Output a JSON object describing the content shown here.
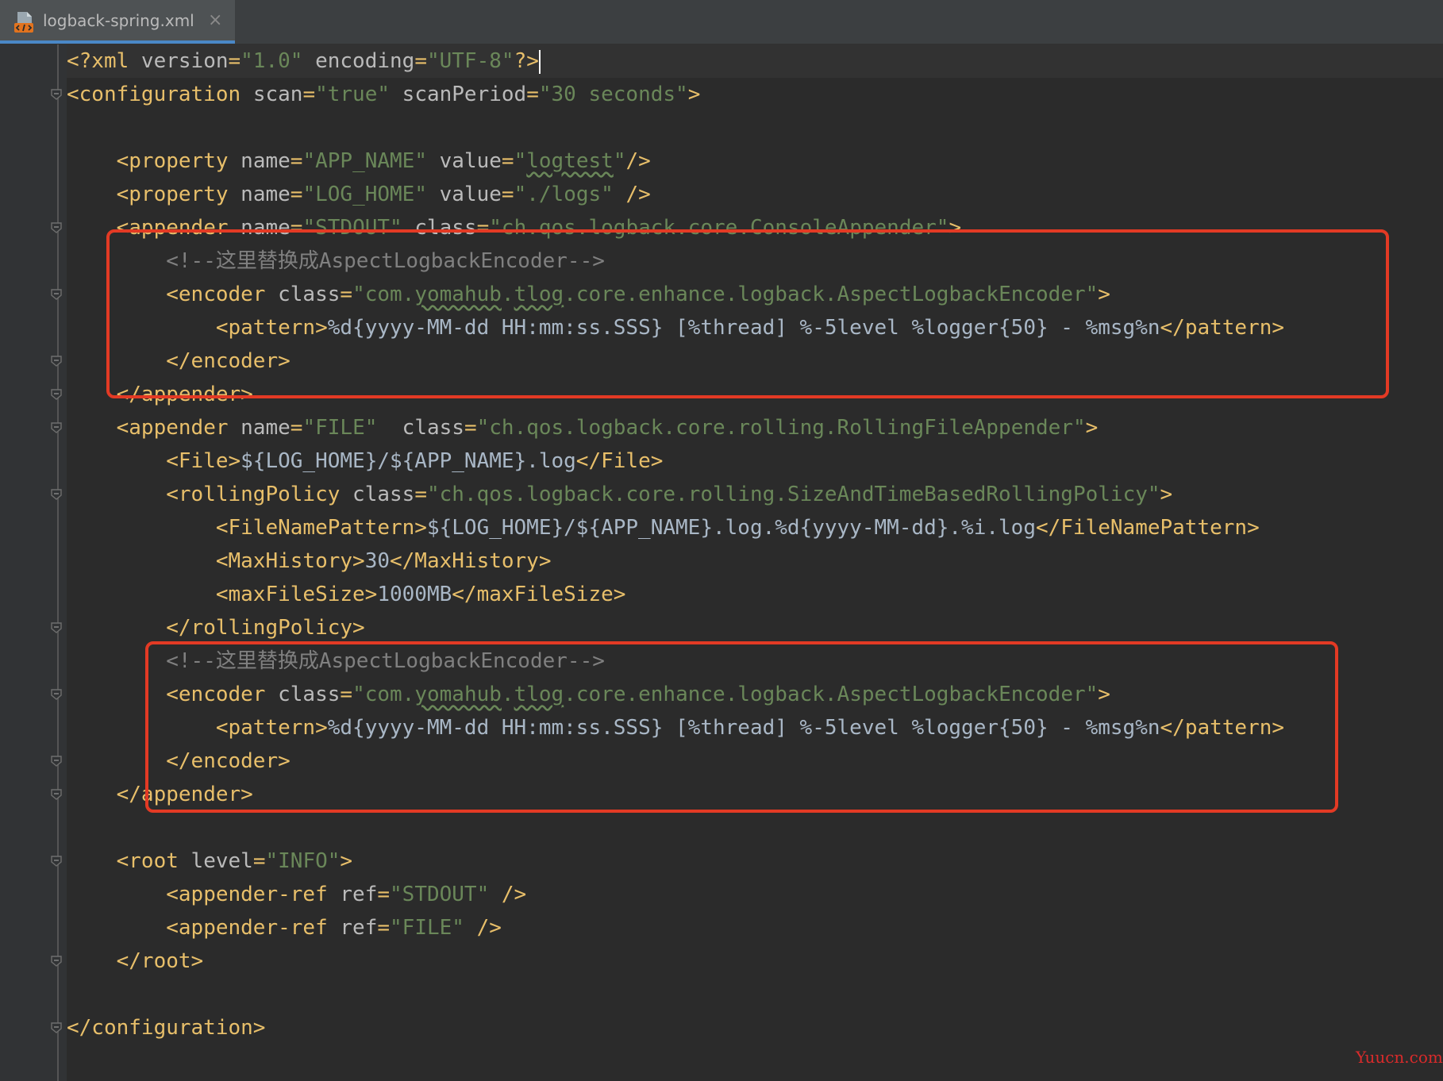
{
  "tab": {
    "filename": "logback-spring.xml",
    "close_glyph": "×",
    "icon": "xml-file-icon"
  },
  "code": [
    [
      [
        "tag",
        "<?xml "
      ],
      [
        "attr",
        "version"
      ],
      [
        "tag",
        "="
      ],
      [
        "val",
        "\"1.0\""
      ],
      [
        "attr",
        " encoding"
      ],
      [
        "tag",
        "="
      ],
      [
        "val",
        "\"UTF-8\""
      ],
      [
        "tag",
        "?>"
      ]
    ],
    [
      [
        "tag",
        "<configuration "
      ],
      [
        "attr",
        "scan"
      ],
      [
        "tag",
        "="
      ],
      [
        "val",
        "\"true\""
      ],
      [
        "attr",
        " scanPeriod"
      ],
      [
        "tag",
        "="
      ],
      [
        "val",
        "\"30 seconds\""
      ],
      [
        "tag",
        ">"
      ]
    ],
    [],
    [
      [
        "txt",
        "    "
      ],
      [
        "tag",
        "<property "
      ],
      [
        "attr",
        "name"
      ],
      [
        "tag",
        "="
      ],
      [
        "val",
        "\"APP_NAME\""
      ],
      [
        "attr",
        " value"
      ],
      [
        "tag",
        "="
      ],
      [
        "val",
        "\""
      ],
      [
        "valsq",
        "logtest"
      ],
      [
        "val",
        "\""
      ],
      [
        "tag",
        "/>"
      ]
    ],
    [
      [
        "txt",
        "    "
      ],
      [
        "tag",
        "<property "
      ],
      [
        "attr",
        "name"
      ],
      [
        "tag",
        "="
      ],
      [
        "val",
        "\"LOG_HOME\""
      ],
      [
        "attr",
        " value"
      ],
      [
        "tag",
        "="
      ],
      [
        "val",
        "\"./logs\""
      ],
      [
        "tag",
        " />"
      ]
    ],
    [
      [
        "txt",
        "    "
      ],
      [
        "tag",
        "<appender "
      ],
      [
        "attr",
        "name"
      ],
      [
        "tag",
        "="
      ],
      [
        "val",
        "\"STDOUT\""
      ],
      [
        "attr",
        " class"
      ],
      [
        "tag",
        "="
      ],
      [
        "val",
        "\"ch.qos.logback.core.ConsoleAppender\""
      ],
      [
        "tag",
        ">"
      ]
    ],
    [
      [
        "txt",
        "        "
      ],
      [
        "comment",
        "<!--这里替换成AspectLogbackEncoder-->"
      ]
    ],
    [
      [
        "txt",
        "        "
      ],
      [
        "tag",
        "<encoder "
      ],
      [
        "attr",
        "class"
      ],
      [
        "tag",
        "="
      ],
      [
        "val",
        "\"com."
      ],
      [
        "valsq",
        "yomahub"
      ],
      [
        "val",
        "."
      ],
      [
        "valsq",
        "tlog"
      ],
      [
        "val",
        ".core.enhance.logback.AspectLogbackEncoder\""
      ],
      [
        "tag",
        ">"
      ]
    ],
    [
      [
        "txt",
        "            "
      ],
      [
        "tag",
        "<pattern>"
      ],
      [
        "txt",
        "%d{yyyy-MM-dd HH:mm:ss.SSS} [%thread] %-5level %logger{50} - %msg%n"
      ],
      [
        "tag",
        "</pattern>"
      ]
    ],
    [
      [
        "txt",
        "        "
      ],
      [
        "tag",
        "</encoder>"
      ]
    ],
    [
      [
        "txt",
        "    "
      ],
      [
        "tag",
        "</appender>"
      ]
    ],
    [
      [
        "txt",
        "    "
      ],
      [
        "tag",
        "<appender "
      ],
      [
        "attr",
        "name"
      ],
      [
        "tag",
        "="
      ],
      [
        "val",
        "\"FILE\""
      ],
      [
        "attr",
        "  class"
      ],
      [
        "tag",
        "="
      ],
      [
        "val",
        "\"ch.qos.logback.core.rolling.RollingFileAppender\""
      ],
      [
        "tag",
        ">"
      ]
    ],
    [
      [
        "txt",
        "        "
      ],
      [
        "tag",
        "<File>"
      ],
      [
        "txt",
        "${LOG_HOME}/${APP_NAME}.log"
      ],
      [
        "tag",
        "</File>"
      ]
    ],
    [
      [
        "txt",
        "        "
      ],
      [
        "tag",
        "<rollingPolicy "
      ],
      [
        "attr",
        "class"
      ],
      [
        "tag",
        "="
      ],
      [
        "val",
        "\"ch.qos.logback.core.rolling.SizeAndTimeBasedRollingPolicy\""
      ],
      [
        "tag",
        ">"
      ]
    ],
    [
      [
        "txt",
        "            "
      ],
      [
        "tag",
        "<FileNamePattern>"
      ],
      [
        "txt",
        "${LOG_HOME}/${APP_NAME}.log.%d{yyyy-MM-dd}.%i.log"
      ],
      [
        "tag",
        "</FileNamePattern>"
      ]
    ],
    [
      [
        "txt",
        "            "
      ],
      [
        "tag",
        "<MaxHistory>"
      ],
      [
        "txt",
        "30"
      ],
      [
        "tag",
        "</MaxHistory>"
      ]
    ],
    [
      [
        "txt",
        "            "
      ],
      [
        "tag",
        "<maxFileSize>"
      ],
      [
        "txt",
        "1000MB"
      ],
      [
        "tag",
        "</maxFileSize>"
      ]
    ],
    [
      [
        "txt",
        "        "
      ],
      [
        "tag",
        "</rollingPolicy>"
      ]
    ],
    [
      [
        "txt",
        "        "
      ],
      [
        "comment",
        "<!--这里替换成AspectLogbackEncoder-->"
      ]
    ],
    [
      [
        "txt",
        "        "
      ],
      [
        "tag",
        "<encoder "
      ],
      [
        "attr",
        "class"
      ],
      [
        "tag",
        "="
      ],
      [
        "val",
        "\"com."
      ],
      [
        "valsq",
        "yomahub"
      ],
      [
        "val",
        "."
      ],
      [
        "valsq",
        "tlog"
      ],
      [
        "val",
        ".core.enhance.logback.AspectLogbackEncoder\""
      ],
      [
        "tag",
        ">"
      ]
    ],
    [
      [
        "txt",
        "            "
      ],
      [
        "tag",
        "<pattern>"
      ],
      [
        "txt",
        "%d{yyyy-MM-dd HH:mm:ss.SSS} [%thread] %-5level %logger{50} - %msg%n"
      ],
      [
        "tag",
        "</pattern>"
      ]
    ],
    [
      [
        "txt",
        "        "
      ],
      [
        "tag",
        "</encoder>"
      ]
    ],
    [
      [
        "txt",
        "    "
      ],
      [
        "tag",
        "</appender>"
      ]
    ],
    [],
    [
      [
        "txt",
        "    "
      ],
      [
        "tag",
        "<root "
      ],
      [
        "attr",
        "level"
      ],
      [
        "tag",
        "="
      ],
      [
        "val",
        "\"INFO\""
      ],
      [
        "tag",
        ">"
      ]
    ],
    [
      [
        "txt",
        "        "
      ],
      [
        "tag",
        "<appender-ref "
      ],
      [
        "attr",
        "ref"
      ],
      [
        "tag",
        "="
      ],
      [
        "val",
        "\"STDOUT\""
      ],
      [
        "tag",
        " />"
      ]
    ],
    [
      [
        "txt",
        "        "
      ],
      [
        "tag",
        "<appender-ref "
      ],
      [
        "attr",
        "ref"
      ],
      [
        "tag",
        "="
      ],
      [
        "val",
        "\"FILE\""
      ],
      [
        "tag",
        " />"
      ]
    ],
    [
      [
        "txt",
        "    "
      ],
      [
        "tag",
        "</root>"
      ]
    ],
    [],
    [
      [
        "tag",
        "</configuration>"
      ]
    ]
  ],
  "fold_lines": [
    1,
    5,
    7,
    9,
    10,
    11,
    13,
    17,
    19,
    21,
    22,
    24,
    27,
    29
  ],
  "colors": {
    "highlight_box": "#e33a24",
    "tag": "#e8bf6a",
    "attribute": "#bababa",
    "value": "#6a8759",
    "text": "#a9b7c6",
    "comment": "#808080",
    "background": "#2b2b2b"
  },
  "watermark": "Yuucn.com"
}
